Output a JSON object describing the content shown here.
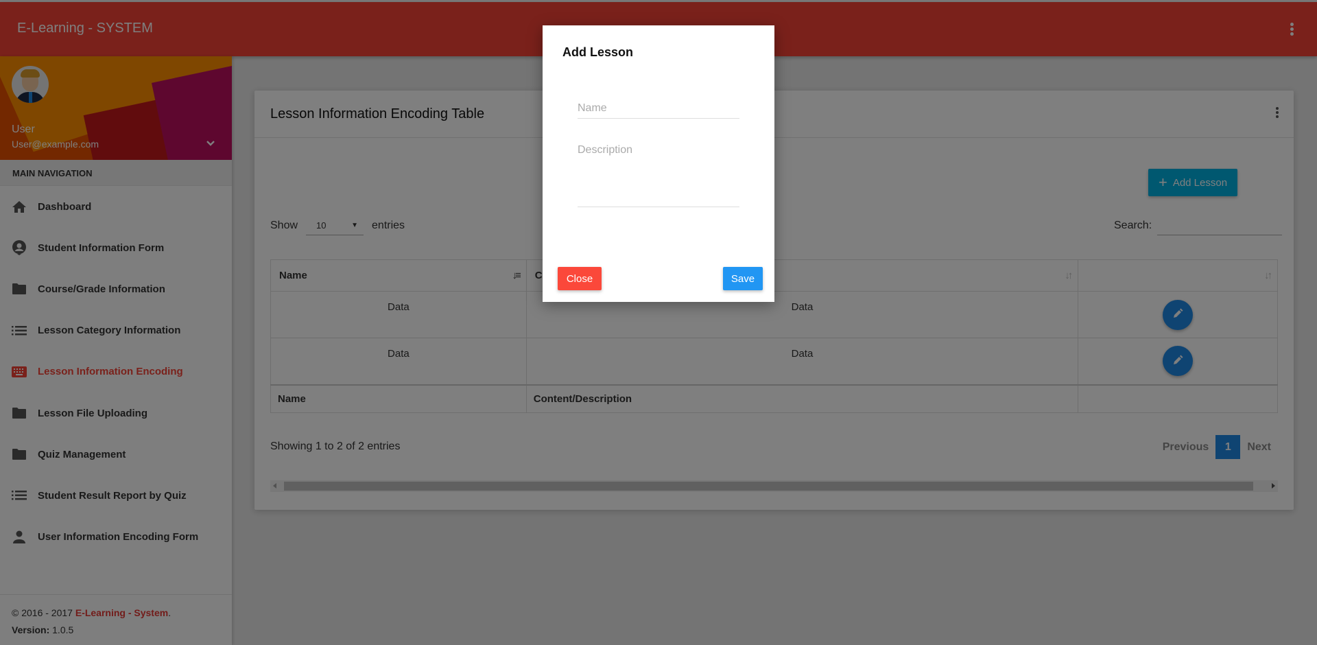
{
  "app": {
    "title": "E-Learning - SYSTEM"
  },
  "user": {
    "name": "User",
    "email": "User@example.com"
  },
  "sidebar": {
    "section_header": "MAIN NAVIGATION",
    "items": [
      {
        "label": "Dashboard",
        "icon": "home-icon"
      },
      {
        "label": "Student Information Form",
        "icon": "account-circle-icon"
      },
      {
        "label": "Course/Grade Information",
        "icon": "folder-icon"
      },
      {
        "label": "Lesson Category Information",
        "icon": "list-icon"
      },
      {
        "label": "Lesson Information Encoding",
        "icon": "keyboard-icon",
        "active": true
      },
      {
        "label": "Lesson File Uploading",
        "icon": "folder-icon"
      },
      {
        "label": "Quiz Management",
        "icon": "folder-icon"
      },
      {
        "label": "Student Result Report by Quiz",
        "icon": "list-icon"
      },
      {
        "label": "User Information Encoding Form",
        "icon": "person-icon"
      }
    ],
    "footer": {
      "copyright": "© 2016 - 2017 ",
      "brand": "E-Learning - System",
      "brand_suffix": ".",
      "version_label": "Version:",
      "version_value": " 1.0.5"
    }
  },
  "card": {
    "title": "Lesson Information Encoding Table",
    "add_button": "Add Lesson",
    "length": {
      "show": "Show",
      "value": "10",
      "entries": "entries"
    },
    "search": {
      "label": "Search:",
      "value": ""
    },
    "table": {
      "headers": [
        "Name",
        "Content/Description",
        ""
      ],
      "footers": [
        "Name",
        "Content/Description",
        ""
      ],
      "rows": [
        {
          "name": "Data",
          "description": "Data"
        },
        {
          "name": "Data",
          "description": "Data"
        }
      ]
    },
    "info": "Showing 1 to 2 of 2 entries",
    "pagination": {
      "previous": "Previous",
      "current": "1",
      "next": "Next"
    }
  },
  "modal": {
    "title": "Add Lesson",
    "name_placeholder": "Name",
    "name_value": "",
    "description_placeholder": "Description",
    "description_value": "",
    "close_label": "Close",
    "save_label": "Save"
  },
  "colors": {
    "primary": "#f44336",
    "add_button": "#00b0e0",
    "edit_button": "#1e88e5",
    "close_button": "#fb483a",
    "save_button": "#2196f3"
  }
}
